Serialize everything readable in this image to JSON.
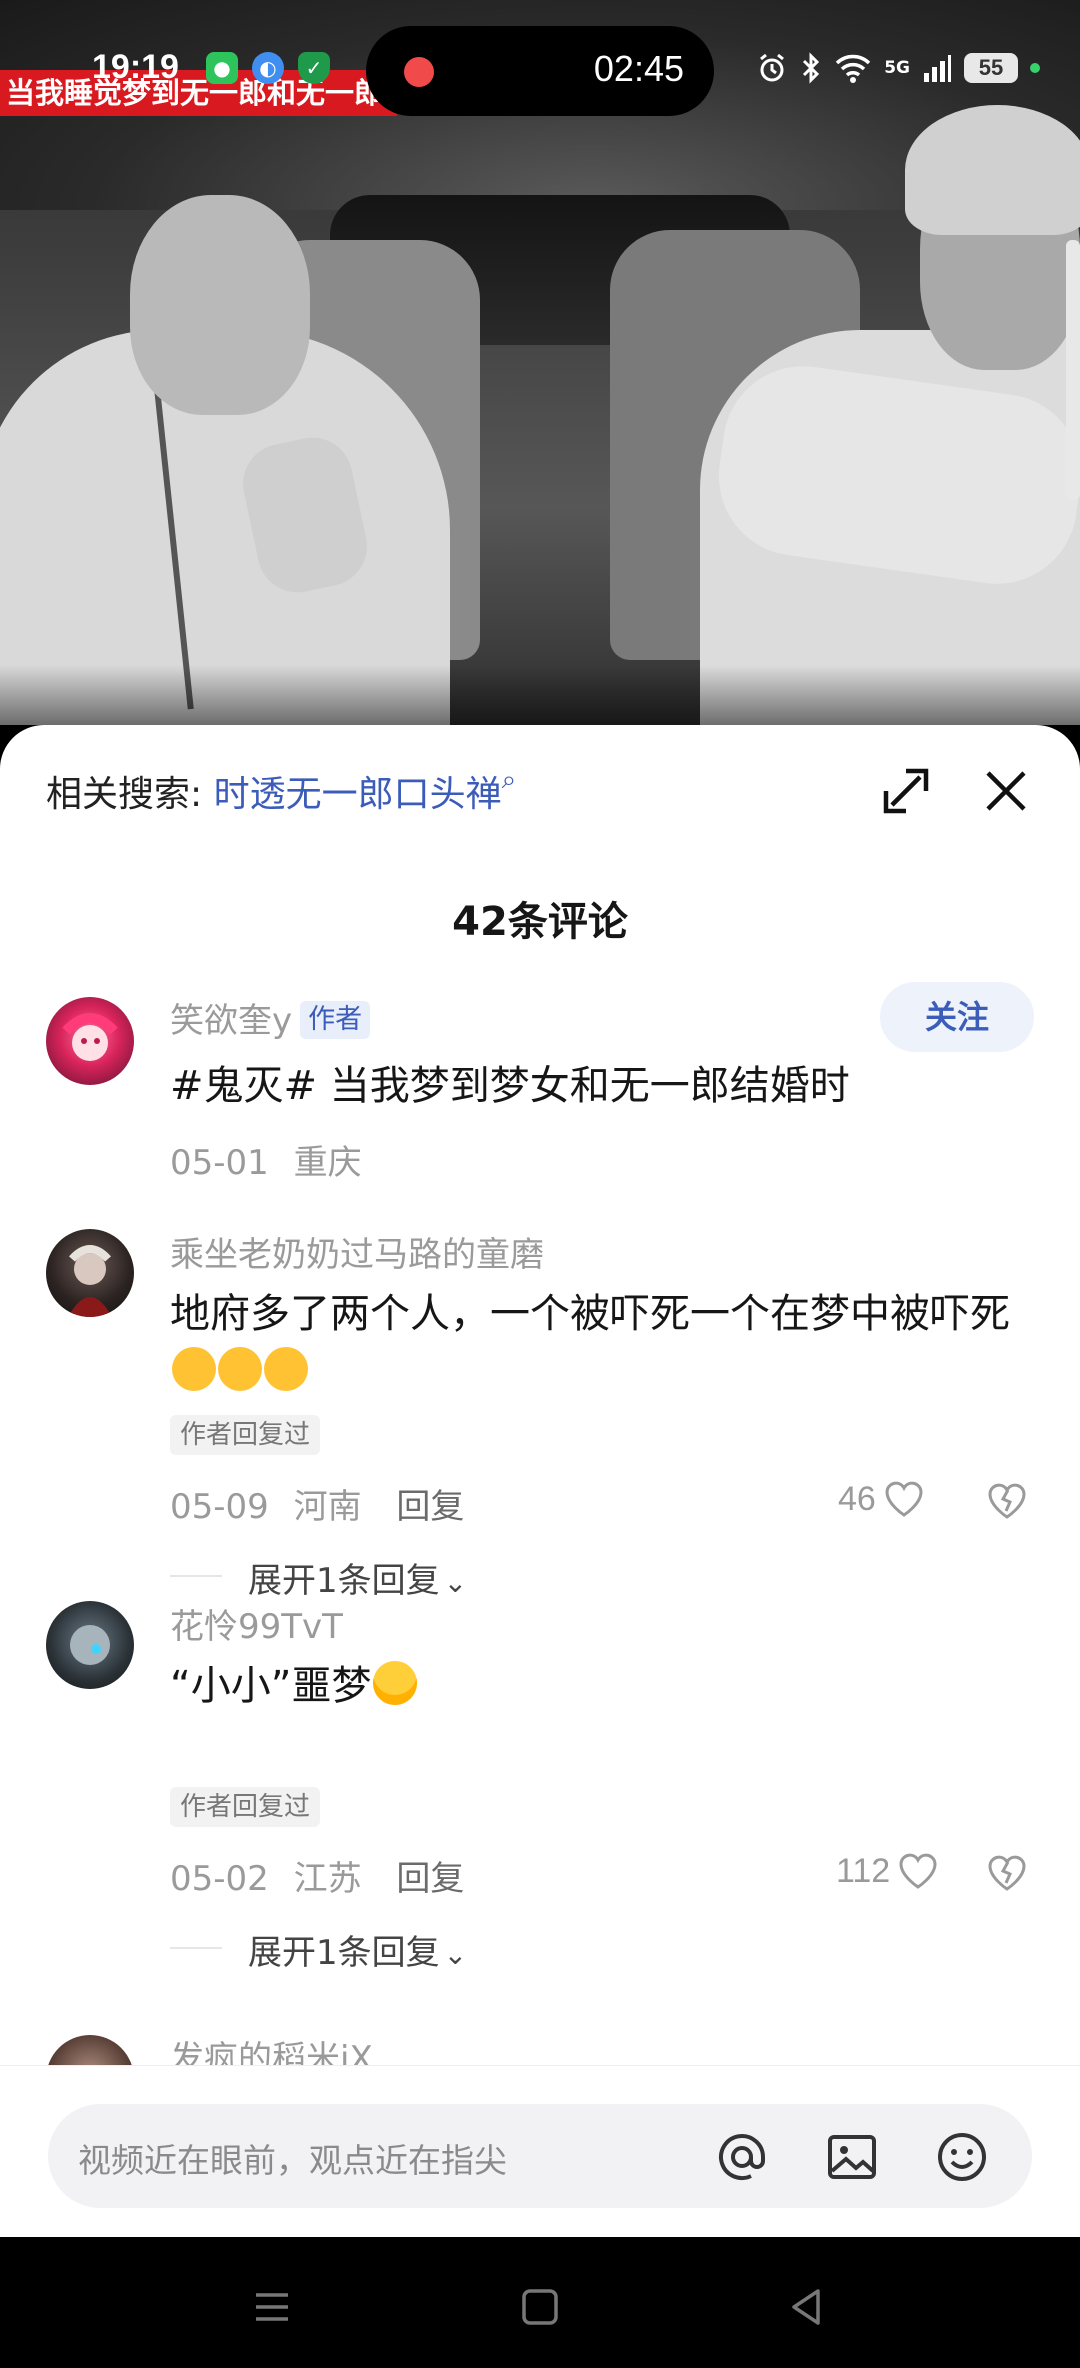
{
  "status_bar": {
    "time": "19:19",
    "recording_time": "02:45",
    "network": "5G",
    "battery": "55",
    "icons": [
      "wechat-icon",
      "browser-icon",
      "shield-icon",
      "alarm-icon",
      "bluetooth-icon",
      "wifi-icon",
      "signal-icon"
    ]
  },
  "video": {
    "caption": "当我睡觉梦到无一郎和无一郎"
  },
  "sheet": {
    "related_label": "相关搜索:",
    "related_query": "时透无一郎口头禅",
    "comment_count_title": "42条评论",
    "accent_color": "#3c5cb9"
  },
  "comments": [
    {
      "username": "笑欲奎y",
      "author_tag": "作者",
      "text": "#鬼灭# 当我梦到梦女和无一郎结婚时",
      "date": "05-01",
      "location": "重庆",
      "follow_label": "关注"
    },
    {
      "username": "乘坐老奶奶过马路的童磨",
      "text": "地府多了两个人，一个被吓死一个在梦中被吓死",
      "replied_tag": "作者回复过",
      "date": "05-09",
      "location": "河南",
      "reply_label": "回复",
      "likes": "46",
      "expand_label": "展开1条回复"
    },
    {
      "username": "花怜99TvT",
      "text": "“小小”噩梦",
      "replied_tag": "作者回复过",
      "date": "05-02",
      "location": "江苏",
      "reply_label": "回复",
      "likes": "112",
      "expand_label": "展开1条回复"
    },
    {
      "username": "发疯的稻米iX"
    }
  ],
  "input": {
    "placeholder": "视频近在眼前，观点近在指尖"
  }
}
